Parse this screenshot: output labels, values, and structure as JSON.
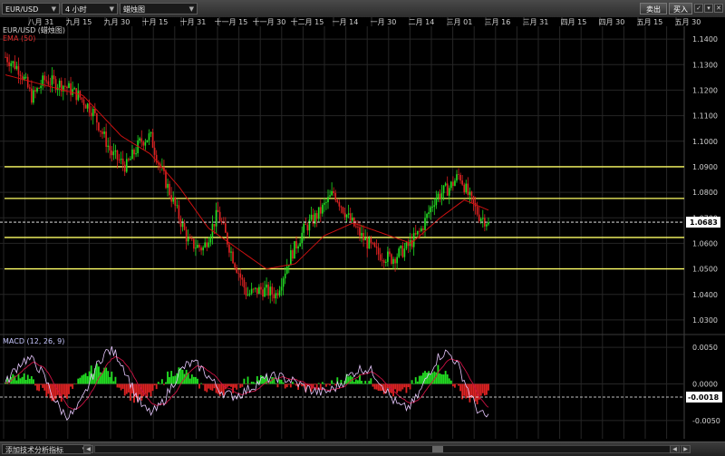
{
  "toolbar": {
    "symbol": "EUR/USD",
    "timeframe": "4 小时",
    "chart_type": "蜡烛图",
    "sell_label": "卖出",
    "buy_label": "买入"
  },
  "bottom": {
    "add_indicator": "添加技术分析指标"
  },
  "legend": {
    "price_title": "EUR/USD (蜡烛图)",
    "ema_label": "EMA (50)",
    "macd_label": "MACD (12, 26, 9)"
  },
  "colors": {
    "bull": "#22dd22",
    "bear": "#dd2222",
    "ema": "#cc1111",
    "hline": "#ffff66",
    "macd": "#e8c8ff",
    "signal": "#cc1144",
    "grid": "#262626"
  },
  "chart_data": {
    "type": "candlestick",
    "title": "EUR/USD",
    "x_ticks": [
      "八月 31",
      "九月 15",
      "九月 30",
      "十月 15",
      "十月 31",
      "十一月 15",
      "十一月 30",
      "十二月 15",
      "一月 14",
      "一月 30",
      "二月 14",
      "三月 01",
      "三月 16",
      "三月 31",
      "四月 15",
      "四月 30",
      "五月 15",
      "五月 30"
    ],
    "y_ticks": [
      "1.1400",
      "1.1300",
      "1.1200",
      "1.1100",
      "1.1000",
      "1.0900",
      "1.0800",
      "1.0700",
      "1.0600",
      "1.0500",
      "1.0400",
      "1.0300"
    ],
    "ylim": [
      1.025,
      1.145
    ],
    "last_price": "1.0683",
    "last_price_value": 1.0683,
    "horizontal_lines": [
      1.09,
      1.0776,
      1.0623,
      1.05
    ],
    "price_anchors": [
      [
        0,
        1.133
      ],
      [
        0.03,
        1.128
      ],
      [
        0.055,
        1.117
      ],
      [
        0.08,
        1.124
      ],
      [
        0.12,
        1.122
      ],
      [
        0.15,
        1.118
      ],
      [
        0.18,
        1.112
      ],
      [
        0.22,
        1.095
      ],
      [
        0.25,
        1.09
      ],
      [
        0.28,
        1.1
      ],
      [
        0.3,
        1.102
      ],
      [
        0.32,
        1.09
      ],
      [
        0.35,
        1.075
      ],
      [
        0.38,
        1.06
      ],
      [
        0.41,
        1.058
      ],
      [
        0.44,
        1.072
      ],
      [
        0.47,
        1.055
      ],
      [
        0.5,
        1.04
      ],
      [
        0.53,
        1.042
      ],
      [
        0.56,
        1.04
      ],
      [
        0.59,
        1.055
      ],
      [
        0.62,
        1.066
      ],
      [
        0.65,
        1.072
      ],
      [
        0.68,
        1.08
      ],
      [
        0.71,
        1.07
      ],
      [
        0.74,
        1.062
      ],
      [
        0.77,
        1.056
      ],
      [
        0.8,
        1.054
      ],
      [
        0.83,
        1.058
      ],
      [
        0.86,
        1.065
      ],
      [
        0.89,
        1.078
      ],
      [
        0.92,
        1.082
      ],
      [
        0.94,
        1.087
      ],
      [
        0.96,
        1.078
      ],
      [
        0.98,
        1.071
      ],
      [
        1.0,
        1.0683
      ]
    ],
    "ema_anchors": [
      [
        0,
        1.126
      ],
      [
        0.08,
        1.122
      ],
      [
        0.16,
        1.118
      ],
      [
        0.24,
        1.102
      ],
      [
        0.3,
        1.095
      ],
      [
        0.36,
        1.082
      ],
      [
        0.42,
        1.066
      ],
      [
        0.48,
        1.058
      ],
      [
        0.54,
        1.05
      ],
      [
        0.6,
        1.052
      ],
      [
        0.66,
        1.063
      ],
      [
        0.72,
        1.068
      ],
      [
        0.78,
        1.064
      ],
      [
        0.84,
        1.06
      ],
      [
        0.9,
        1.07
      ],
      [
        0.95,
        1.077
      ],
      [
        1.0,
        1.073
      ]
    ],
    "macd": {
      "label": "MACD (12, 26, 9)",
      "y_ticks": [
        "0.0050",
        "0.0000",
        "-0.0050"
      ],
      "ylim": [
        -0.0075,
        0.0065
      ],
      "last_value": "-0.0018",
      "last_value_num": -0.0018
    }
  }
}
